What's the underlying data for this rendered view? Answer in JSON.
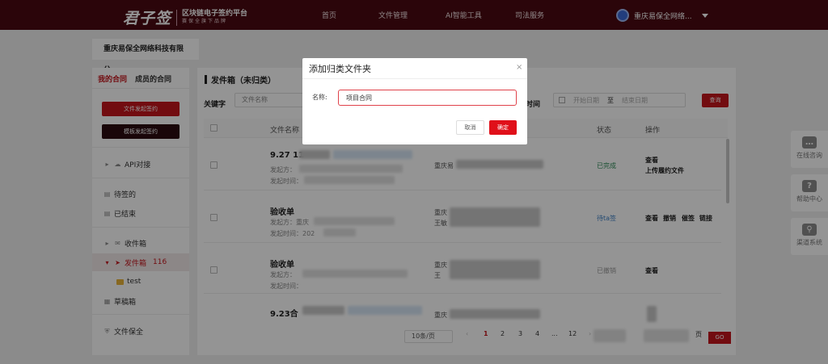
{
  "header": {
    "logo": "君子签",
    "logo_sub1": "区块链电子签约平台",
    "logo_sub2": "赛保全旗下品牌",
    "nav": [
      "首页",
      "文件管理",
      "AI智能工具",
      "司法服务"
    ],
    "user": "重庆易保全网络..."
  },
  "company_tab": "重庆易保全网络科技有限公...",
  "sidebar": {
    "tabs": [
      "我的合同",
      "成员的合同"
    ],
    "start_sign": "文件发起签约",
    "template_sign": "模板发起签约",
    "api": "API对接",
    "pending": "待签的",
    "finished": "已结束",
    "inbox": "收件箱",
    "outbox": "发件箱",
    "outbox_count": "116",
    "folder": "test",
    "drafts": "草稿箱",
    "preservation": "文件保全"
  },
  "main": {
    "title": "发件箱（未归类）",
    "keyword_label": "关键字",
    "keyword_select": "文件名称",
    "time_label": "时间",
    "date_start": "开始日期",
    "date_to": "至",
    "date_end": "结束日期",
    "search": "查询",
    "columns": {
      "name": "文件名称",
      "status": "状态",
      "action": "操作"
    },
    "rows": [
      {
        "title": "9.27 11",
        "initiator": "发起方：",
        "time": "发起时间：",
        "party": "重庆易",
        "status": "已完成",
        "status_color": "#2e8b57",
        "actions": [
          "查看",
          "上传履约文件"
        ]
      },
      {
        "title": "验收单",
        "initiator": "发起方：重庆",
        "time": "发起时间：202",
        "party": "重庆",
        "party2": "王敏",
        "status": "待ta签",
        "status_color": "#3b7fc4",
        "actions": [
          "查看",
          "撤销",
          "催签",
          "链接"
        ]
      },
      {
        "title": "验收单",
        "initiator": "发起方：",
        "time": "发起时间：",
        "party": "重庆",
        "party2": "王",
        "status": "已撤销",
        "status_color": "#999999",
        "actions": [
          "查看"
        ]
      },
      {
        "title": "9.23合",
        "initiator": "",
        "time": "",
        "party": "重庆",
        "status": "",
        "status_color": "#999999",
        "actions": []
      }
    ],
    "pagination": {
      "page_size": "10条/页",
      "pages": [
        "1",
        "2",
        "3",
        "4",
        "...",
        "12"
      ],
      "prev": "‹",
      "next": "›",
      "page_unit": "页",
      "go": "GO"
    }
  },
  "float_help": [
    {
      "label": "在线咨询",
      "icon": "chat-icon",
      "glyph": "…"
    },
    {
      "label": "帮助中心",
      "icon": "help-icon",
      "glyph": "?"
    },
    {
      "label": "渠道系统",
      "icon": "org-chart-icon",
      "glyph": "⚲"
    }
  ],
  "modal": {
    "title": "添加归类文件夹",
    "close": "×",
    "name_label": "名称:",
    "name_value": "项目合同",
    "cancel": "取消",
    "confirm": "确定"
  }
}
